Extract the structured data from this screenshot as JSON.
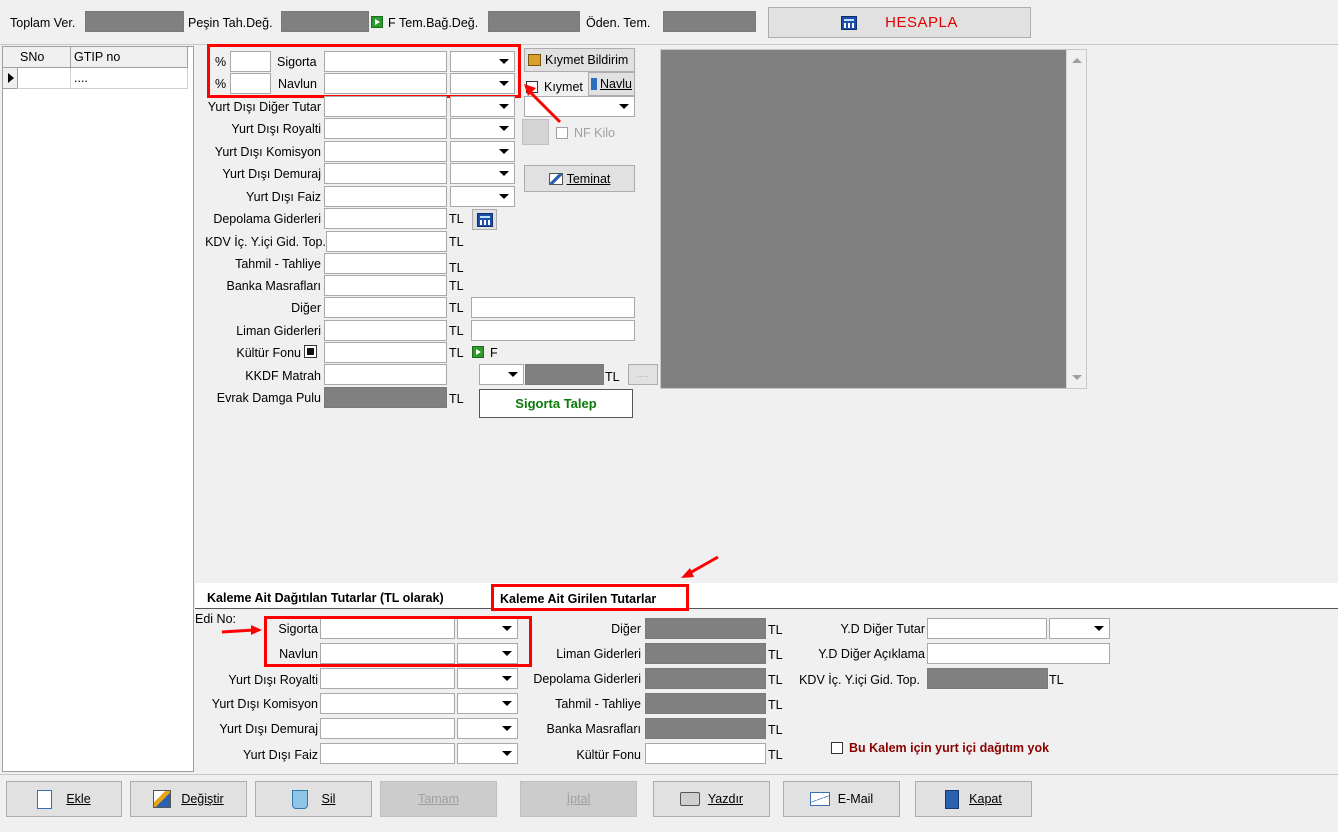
{
  "top": {
    "toplam_ver": "Toplam Ver.",
    "pesin_tah": "Peşin Tah.Değ.",
    "f_letter": "F",
    "tem_bag": "Tem.Bağ.Değ.",
    "oden_tem": "Öden. Tem.",
    "hesapla": "HESAPLA"
  },
  "grid": {
    "col_sno": "SNo",
    "col_gtip": "GTIP no",
    "row_gtip": "...."
  },
  "form": {
    "pct": "%",
    "sigorta": "Sigorta",
    "navlun": "Navlun",
    "yd_diger_tutar": "Yurt Dışı Diğer Tutar",
    "yd_royalti": "Yurt Dışı Royalti",
    "yd_komisyon": "Yurt Dışı Komisyon",
    "yd_demuraj": "Yurt Dışı Demuraj",
    "yd_faiz": "Yurt Dışı Faiz",
    "depolama": "Depolama Giderleri",
    "kdv_ic": "KDV İç. Y.içi Gid. Top.",
    "tahmil": "Tahmil - Tahliye",
    "banka": "Banka Masrafları",
    "diger": "Diğer",
    "liman": "Liman Giderleri",
    "kultur": "Kültür Fonu",
    "kkdf": "KKDF Matrah",
    "evrak": "Evrak Damga Pulu",
    "tl": "TL",
    "f_letter": "F"
  },
  "side": {
    "kiymet_bildirim": "Kıymet Bildirim",
    "kiymet": "Kıymet",
    "navlu": "Navlu",
    "nf_kilo": "NF Kilo",
    "teminat": "Teminat",
    "sigorta_talep": "Sigorta Talep",
    "ellipsis": "....."
  },
  "tabs": {
    "tab1": "Kaleme Ait Dağıtılan Tutarlar (TL olarak)",
    "tab2": "Kaleme Ait Girilen Tutarlar"
  },
  "bottom": {
    "edi_no": "Edi No:",
    "sigorta": "Sigorta",
    "navlun": "Navlun",
    "yd_royalti": "Yurt Dışı Royalti",
    "yd_komisyon": "Yurt Dışı Komisyon",
    "yd_demuraj": "Yurt Dışı Demuraj",
    "yd_faiz": "Yurt Dışı Faiz",
    "diger": "Diğer",
    "liman": "Liman Giderleri",
    "depolama": "Depolama Giderleri",
    "tahmil": "Tahmil - Tahliye",
    "banka": "Banka Masrafları",
    "kultur": "Kültür Fonu",
    "yd_diger_tutar": "Y.D Diğer Tutar",
    "yd_diger_aciklama": "Y.D Diğer Açıklama",
    "kdv_ic": "KDV İç. Y.içi Gid. Top.",
    "tl": "TL",
    "yurt_ici_yok": "Bu Kalem için yurt içi dağıtım yok"
  },
  "buttons": {
    "ekle": "Ekle",
    "degistir": "Değiştir",
    "sil": "Sil",
    "tamam": "Tamam",
    "iptal": "İptal",
    "yazdir": "Yazdır",
    "email": "E-Mail",
    "kapat": "Kapat"
  },
  "colors": {
    "annotation": "#ff0000",
    "hesapla_text": "#e00000",
    "talep_text": "#0a7a0a",
    "warn_text": "#8b0000",
    "gray_field": "#808080"
  }
}
